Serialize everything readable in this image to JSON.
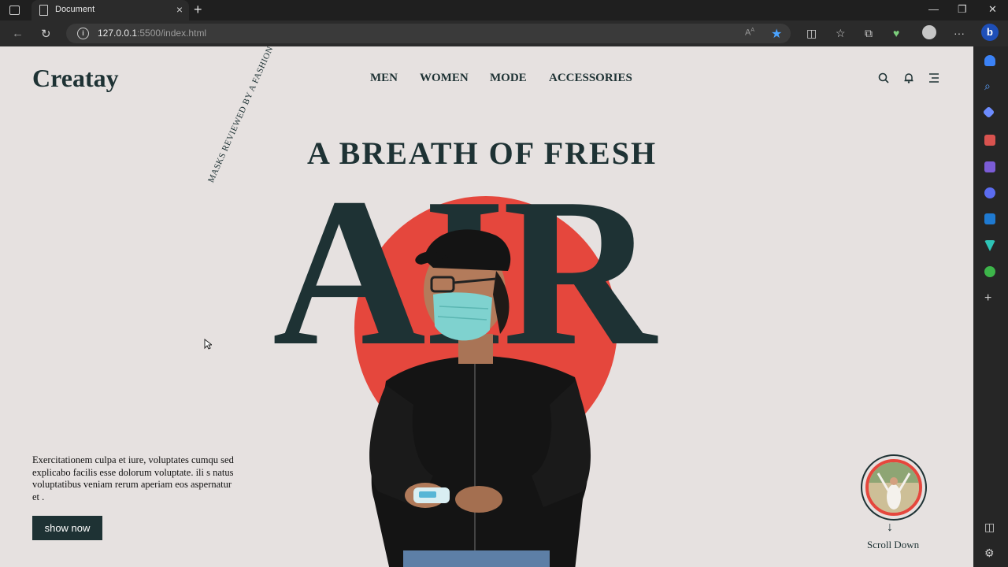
{
  "browser": {
    "tab_title": "Document",
    "url_host": "127.0.0.1",
    "url_rest": ":5500/index.html"
  },
  "site": {
    "logo": "Creatay",
    "nav": [
      "MEN",
      "WOMEN",
      "MODE",
      "ACCESSORIES"
    ],
    "headline": "A BREATH OF FRESH",
    "big_word": "AIR",
    "curved_text": "MASKS REVIEWED BY A FASHION GURU",
    "blurb": "Exercitationem culpa et iure, voluptates cumqu sed explicabo facilis esse dolorum voluptate. ili s natus voluptatibus veniam rerum aperiam eos aspernatur et .",
    "cta": "show now",
    "scroll_label": "Scroll Down"
  },
  "colors": {
    "accent": "#e5473d",
    "dark": "#1e3234",
    "background": "#e6e1e0"
  }
}
